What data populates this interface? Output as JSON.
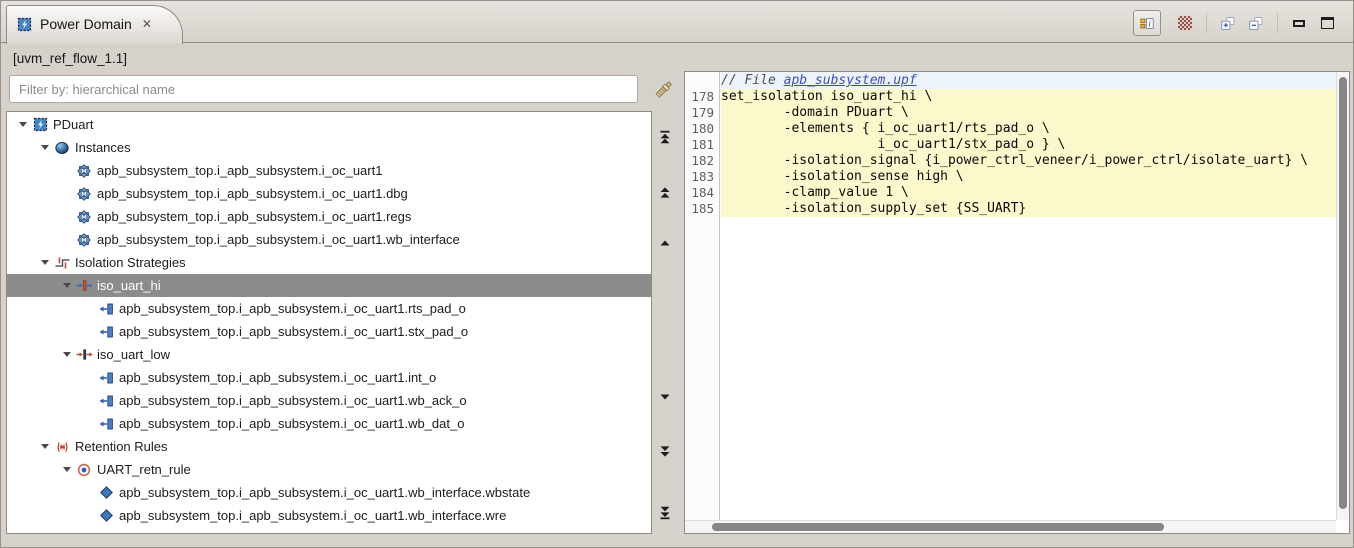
{
  "tab": {
    "title": "Power Domain"
  },
  "scope_label": "[uvm_ref_flow_1.1]",
  "filter": {
    "placeholder": "Filter by: hierarchical name"
  },
  "icons": {
    "close": "✕",
    "module_letter": "M",
    "info_letter": "i"
  },
  "colors": {
    "selection_bg": "#8c8c8c",
    "code_highlight": "#fbf8cc",
    "header_line_bg": "#edf3fb",
    "link": "#3a4fc0",
    "chrome": "#d6d2cb"
  },
  "tree": {
    "items": [
      {
        "level": 0,
        "icon": "power-domain",
        "label": "PDuart",
        "expanded": true
      },
      {
        "level": 1,
        "icon": "instances-group",
        "label": "Instances",
        "expanded": true
      },
      {
        "level": 2,
        "icon": "module-instance",
        "label": "apb_subsystem_top.i_apb_subsystem.i_oc_uart1"
      },
      {
        "level": 2,
        "icon": "module-instance",
        "label": "apb_subsystem_top.i_apb_subsystem.i_oc_uart1.dbg"
      },
      {
        "level": 2,
        "icon": "module-instance",
        "label": "apb_subsystem_top.i_apb_subsystem.i_oc_uart1.regs"
      },
      {
        "level": 2,
        "icon": "module-instance",
        "label": "apb_subsystem_top.i_apb_subsystem.i_oc_uart1.wb_interface"
      },
      {
        "level": 1,
        "icon": "isolation-strategies-group",
        "label": "Isolation Strategies",
        "expanded": true
      },
      {
        "level": 2,
        "icon": "isolation-strategy-high",
        "label": "iso_uart_hi",
        "expanded": true,
        "selected": true
      },
      {
        "level": 3,
        "icon": "port",
        "label": "apb_subsystem_top.i_apb_subsystem.i_oc_uart1.rts_pad_o"
      },
      {
        "level": 3,
        "icon": "port",
        "label": "apb_subsystem_top.i_apb_subsystem.i_oc_uart1.stx_pad_o"
      },
      {
        "level": 2,
        "icon": "isolation-strategy-low",
        "label": "iso_uart_low",
        "expanded": true
      },
      {
        "level": 3,
        "icon": "port",
        "label": "apb_subsystem_top.i_apb_subsystem.i_oc_uart1.int_o"
      },
      {
        "level": 3,
        "icon": "port",
        "label": "apb_subsystem_top.i_apb_subsystem.i_oc_uart1.wb_ack_o"
      },
      {
        "level": 3,
        "icon": "port",
        "label": "apb_subsystem_top.i_apb_subsystem.i_oc_uart1.wb_dat_o"
      },
      {
        "level": 1,
        "icon": "retention-rules-group",
        "label": "Retention Rules",
        "expanded": true
      },
      {
        "level": 2,
        "icon": "retention-rule",
        "label": "UART_retn_rule",
        "expanded": true
      },
      {
        "level": 3,
        "icon": "retention-element",
        "label": "apb_subsystem_top.i_apb_subsystem.i_oc_uart1.wb_interface.wbstate"
      },
      {
        "level": 3,
        "icon": "retention-element",
        "label": "apb_subsystem_top.i_apb_subsystem.i_oc_uart1.wb_interface.wre"
      }
    ]
  },
  "editor": {
    "header": {
      "prefix": "// File ",
      "filename": "apb_subsystem.upf"
    },
    "lines": [
      {
        "num": "178",
        "text": "set_isolation iso_uart_hi \\"
      },
      {
        "num": "179",
        "text": "        -domain PDuart \\"
      },
      {
        "num": "180",
        "text": "        -elements { i_oc_uart1/rts_pad_o \\"
      },
      {
        "num": "181",
        "text": "                    i_oc_uart1/stx_pad_o } \\"
      },
      {
        "num": "182",
        "text": "        -isolation_signal {i_power_ctrl_veneer/i_power_ctrl/isolate_uart} \\"
      },
      {
        "num": "183",
        "text": "        -isolation_sense high \\"
      },
      {
        "num": "184",
        "text": "        -clamp_value 1 \\"
      },
      {
        "num": "185",
        "text": "        -isolation_supply_set {SS_UART}"
      }
    ]
  }
}
